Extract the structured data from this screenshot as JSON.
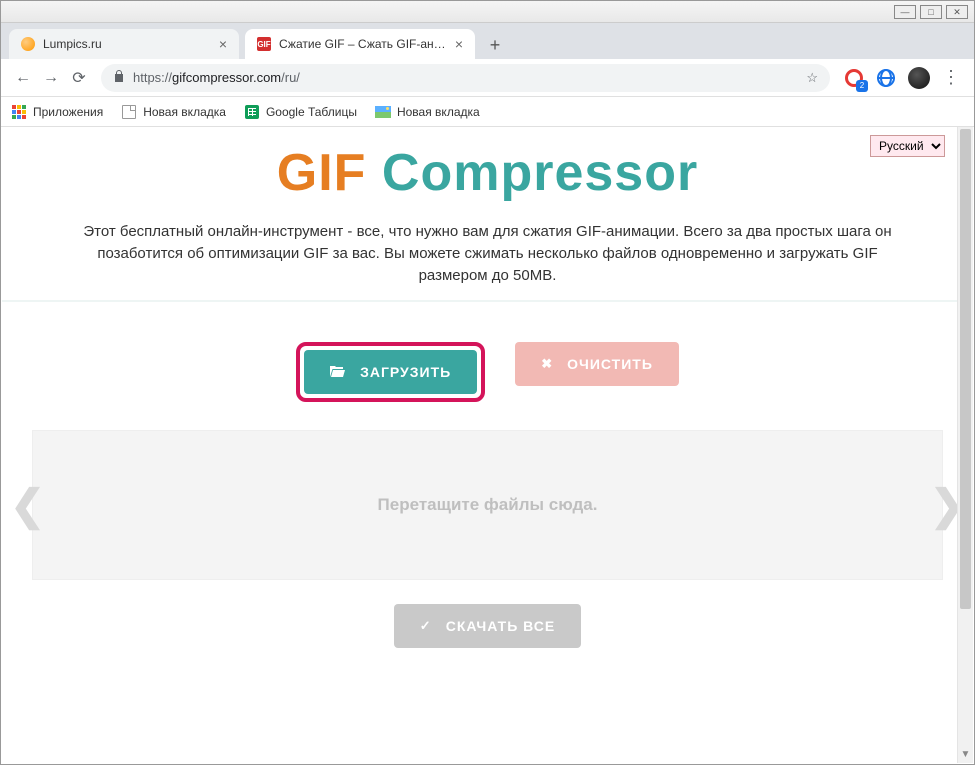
{
  "window": {
    "minimize": "—",
    "maximize": "□",
    "close": "✕"
  },
  "tabs": {
    "items": [
      {
        "title": "Lumpics.ru",
        "favicon": "orange"
      },
      {
        "title": "Сжатие GIF – Сжать GIF-анимац",
        "favicon": "gif"
      }
    ],
    "close_glyph": "×",
    "new_tab_glyph": "+"
  },
  "toolbar": {
    "back": "←",
    "forward": "→",
    "reload": "⟳",
    "url_proto": "https://",
    "url_host": "gifcompressor.com",
    "url_path": "/ru/",
    "star": "☆",
    "badge": "2",
    "menu": "⋮"
  },
  "bookmarks": {
    "items": [
      {
        "label": "Приложения",
        "icon": "apps"
      },
      {
        "label": "Новая вкладка",
        "icon": "page"
      },
      {
        "label": "Google Таблицы",
        "icon": "sheets"
      },
      {
        "label": "Новая вкладка",
        "icon": "pic"
      }
    ]
  },
  "page": {
    "lang_selected": "Русский",
    "logo_part1": "GIF",
    "logo_part2": "Compressor",
    "description": "Этот бесплатный онлайн-инструмент - все, что нужно вам для сжатия GIF-анимации. Всего за два простых шага он позаботится об оптимизации GIF за вас. Вы можете сжимать несколько файлов одновременно и загружать GIF размером до 50MB.",
    "upload_label": "ЗАГРУЗИТЬ",
    "clear_label": "ОЧИСТИТЬ",
    "dropzone_text": "Перетащите файлы сюда.",
    "download_label": "СКАЧАТЬ ВСЕ",
    "chevron_left": "❮",
    "chevron_right": "❯",
    "checkmark": "✓",
    "clear_x": "✖",
    "folder": "📂"
  }
}
